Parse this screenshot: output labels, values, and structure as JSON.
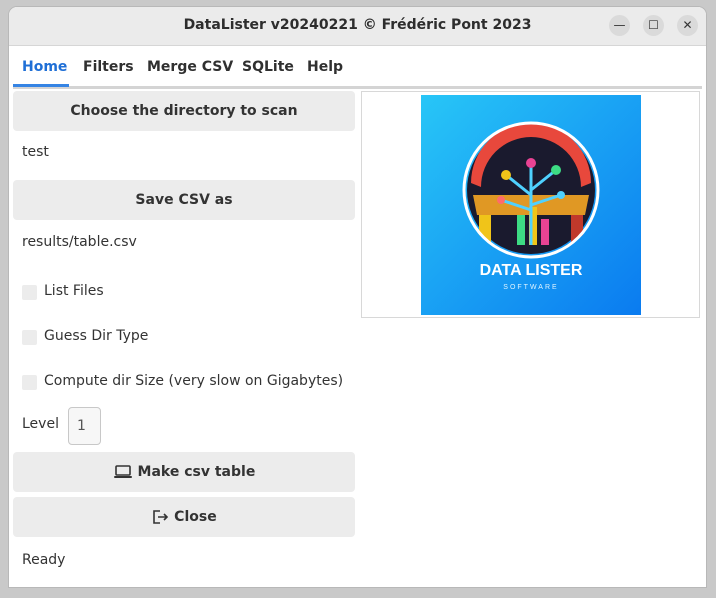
{
  "window": {
    "title": "DataLister v20240221 © Frédéric Pont 2023"
  },
  "tabs": [
    {
      "label": "Home",
      "active": true
    },
    {
      "label": "Filters"
    },
    {
      "label": "Merge CSV"
    },
    {
      "label": "SQLite"
    },
    {
      "label": "Help"
    }
  ],
  "home": {
    "choose_dir_label": "Choose the directory to scan",
    "directory_value": "test",
    "save_csv_label": "Save CSV as",
    "csv_path_value": "results/table.csv",
    "options": [
      {
        "label": "List Files",
        "checked": false
      },
      {
        "label": "Guess Dir Type",
        "checked": false
      },
      {
        "label": "Compute dir Size (very slow on Gigabytes)",
        "checked": false
      }
    ],
    "level_label": "Level",
    "level_value": "1",
    "make_table_label": "Make csv table",
    "close_label": "Close",
    "status": "Ready"
  },
  "logo": {
    "title": "DATA LISTER",
    "subtitle": "SOFTWARE"
  },
  "colors": {
    "accent": "#3584e4",
    "button_bg": "#ececec",
    "logo_bg": "#1aa3f5"
  }
}
